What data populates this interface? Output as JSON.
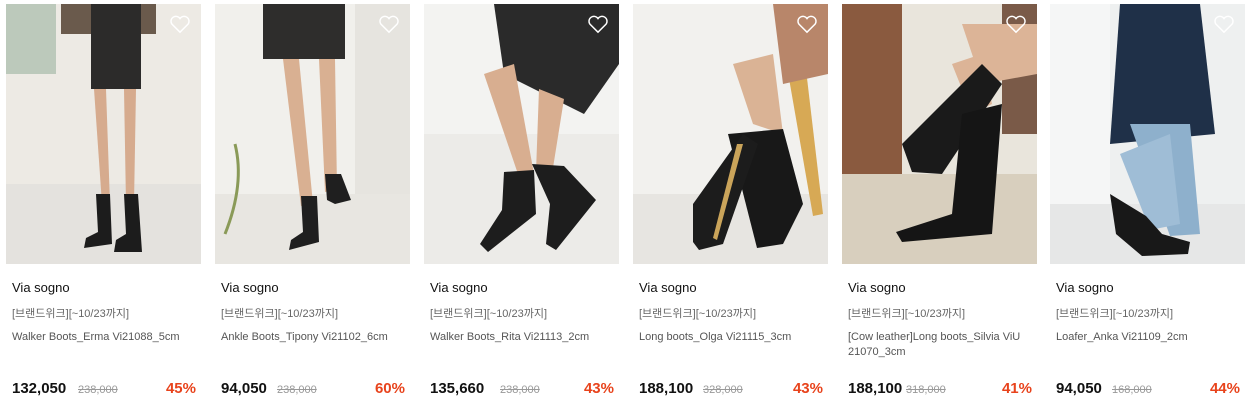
{
  "colors": {
    "discount": "#e8431c",
    "price": "#111111",
    "original_price": "#999999"
  },
  "products": [
    {
      "brand": "Via sogno",
      "tag": "[브랜드위크][~10/23까지]",
      "name": "Walker Boots_Erma Vi21088_5cm",
      "price": "132,050",
      "original_price": "238,000",
      "discount": "45%",
      "heart_icon": "heart-outline-icon"
    },
    {
      "brand": "Via sogno",
      "tag": "[브랜드위크][~10/23까지]",
      "name": "Ankle Boots_Tipony Vi21102_6cm",
      "price": "94,050",
      "original_price": "238,000",
      "discount": "60%",
      "heart_icon": "heart-outline-icon"
    },
    {
      "brand": "Via sogno",
      "tag": "[브랜드위크][~10/23까지]",
      "name": "Walker Boots_Rita Vi21113_2cm",
      "price": "135,660",
      "original_price": "238,000",
      "discount": "43%",
      "heart_icon": "heart-outline-icon"
    },
    {
      "brand": "Via sogno",
      "tag": "[브랜드위크][~10/23까지]",
      "name": "Long boots_Olga Vi21115_3cm",
      "price": "188,100",
      "original_price": "328,000",
      "discount": "43%",
      "heart_icon": "heart-outline-icon"
    },
    {
      "brand": "Via sogno",
      "tag": "[브랜드위크][~10/23까지]",
      "name": "[Cow leather]Long boots_Silvia ViU 21070_3cm",
      "price": "188,100",
      "original_price": "318,000",
      "discount": "41%",
      "heart_icon": "heart-outline-icon"
    },
    {
      "brand": "Via sogno",
      "tag": "[브랜드위크][~10/23까지]",
      "name": "Loafer_Anka Vi21109_2cm",
      "price": "94,050",
      "original_price": "168,000",
      "discount": "44%",
      "heart_icon": "heart-outline-icon"
    }
  ]
}
